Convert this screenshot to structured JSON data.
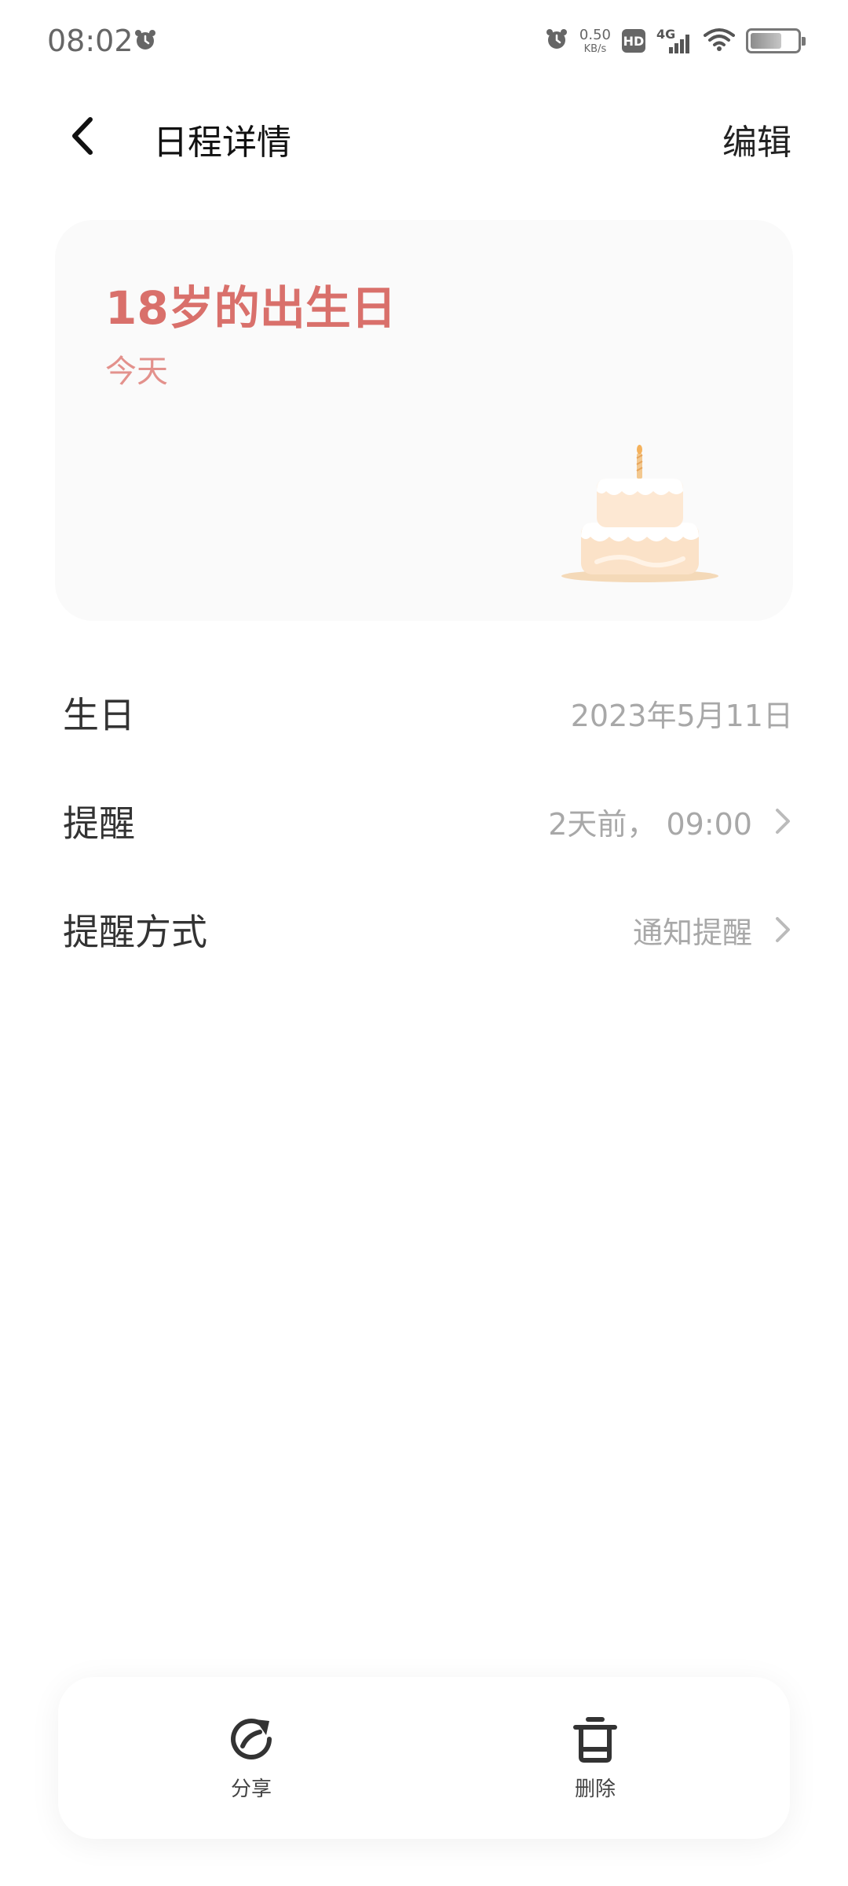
{
  "status_bar": {
    "time": "08:02",
    "net_speed_value": "0.50",
    "net_speed_unit": "KB/s",
    "hd_label": "HD",
    "network_label": "4G",
    "battery_level": 0.7,
    "icons": [
      "alarm-icon",
      "alarm-icon",
      "hd-icon",
      "signal-icon",
      "wifi-icon",
      "battery-icon"
    ]
  },
  "header": {
    "title": "日程详情",
    "edit_label": "编辑",
    "back_icon": "back-arrow-icon"
  },
  "event": {
    "title": "18岁的出生日",
    "date_label": "今天",
    "illustration": "birthday-cake"
  },
  "details": {
    "birthday": {
      "label": "生日",
      "value": "2023年5月11日"
    },
    "reminder": {
      "label": "提醒",
      "value": "2天前， 09:00"
    },
    "method": {
      "label": "提醒方式",
      "value": "通知提醒"
    }
  },
  "actions": {
    "share_label": "分享",
    "delete_label": "删除"
  },
  "colors": {
    "accent_title": "#d9706b",
    "accent_sub": "#e3918c",
    "card_bg": "#fafafa",
    "value_text": "#a8a8a8"
  }
}
